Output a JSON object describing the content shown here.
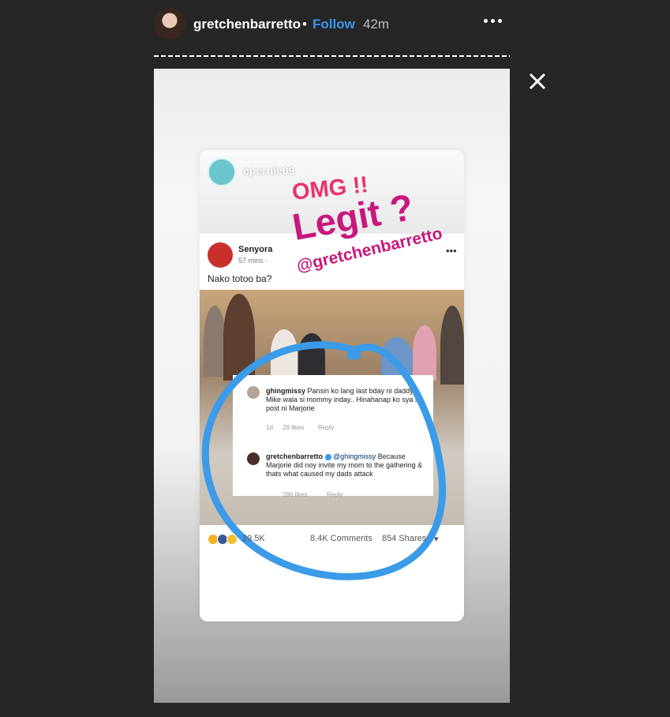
{
  "header": {
    "username": "gretchenbarretto",
    "separator": "•",
    "follow_label": "Follow",
    "time": "42m"
  },
  "story": {
    "sticker_user": "epernie09",
    "text_omg": "OMG !!",
    "text_legit": "Legit ?",
    "text_mention": "@gretchenbarretto",
    "fb_post": {
      "author": "Senyora",
      "time": "57 mins ·",
      "text": "Nako totoo ba?"
    },
    "comments": [
      {
        "user": "ghingmissy",
        "text": "Pansin ko lang last bday ni daddy Mike wala si mommy inday.. Hinahanap ko sya sa post ni Marjorie",
        "meta_age": "1d",
        "meta_likes": "28 likes",
        "meta_reply": "Reply"
      },
      {
        "user": "gretchenbarretto",
        "mention": "@ghingmissy",
        "text": "Because Marjorie did noy invite my mom to the gathering & thats what caused my dads attack",
        "meta_likes": "286 likes",
        "meta_reply": "Reply"
      }
    ],
    "reactions": {
      "count": "29.5K",
      "comments": "8.4K Comments",
      "shares": "854 Shares"
    }
  },
  "colors": {
    "background": "#262626",
    "follow": "#3897f0",
    "magenta": "#c8177e",
    "circle": "#3b9be8"
  }
}
